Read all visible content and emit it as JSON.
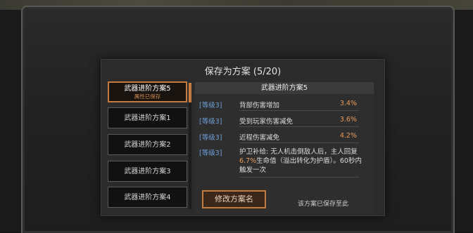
{
  "dialog": {
    "title": "保存为方案 (5/20)"
  },
  "slots": [
    {
      "name": "武器进阶方案5",
      "sub": "属性已保存"
    },
    {
      "name": "武器进阶方案1"
    },
    {
      "name": "武器进阶方案2"
    },
    {
      "name": "武器进阶方案3"
    },
    {
      "name": "武器进阶方案4"
    }
  ],
  "detail": {
    "title": "武器进阶方案5",
    "stats": [
      {
        "level": "[等级3]",
        "name": "背部伤害增加",
        "value": "3.4%"
      },
      {
        "level": "[等级3]",
        "name": "受到玩家伤害减免",
        "value": "3.6%"
      },
      {
        "level": "[等级3]",
        "name": "近程伤害减免",
        "value": "4.2%"
      }
    ],
    "special": {
      "level": "[等级3]",
      "text_a": "护卫补给: 无人机击倒敌人后，主人回复",
      "highlight": "6.7%",
      "text_b": "生命值（溢出转化为护盾）。60秒内触发一次"
    }
  },
  "actions": {
    "rename_label": "修改方案名",
    "saved_note": "该方案已保存至此"
  },
  "colors": {
    "accent": "#c57a3e",
    "value": "#e89a5a",
    "level": "#6f9fd8"
  }
}
